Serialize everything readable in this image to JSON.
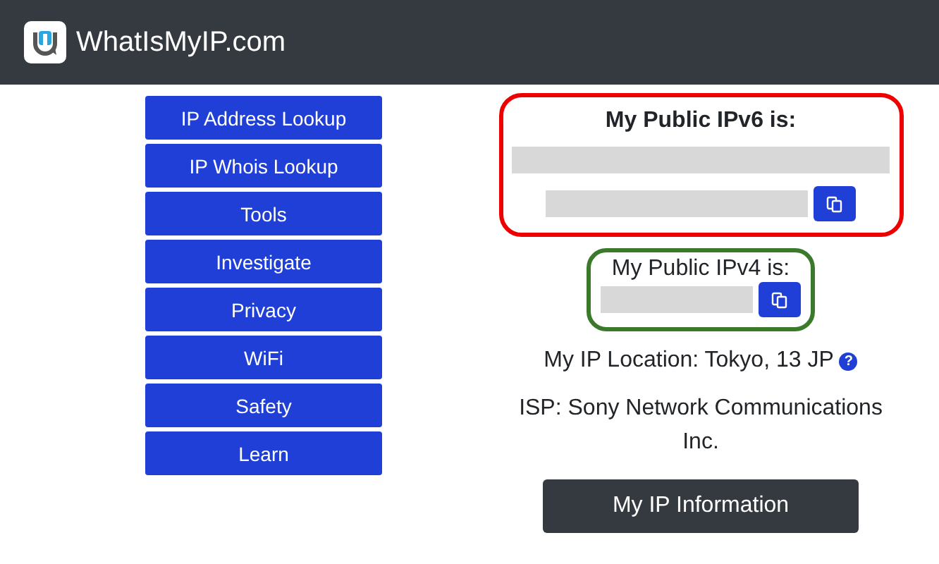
{
  "header": {
    "title": "WhatIsMyIP.com"
  },
  "nav": [
    {
      "label": "IP Address Lookup"
    },
    {
      "label": "IP Whois Lookup"
    },
    {
      "label": "Tools"
    },
    {
      "label": "Investigate"
    },
    {
      "label": "Privacy"
    },
    {
      "label": "WiFi"
    },
    {
      "label": "Safety"
    },
    {
      "label": "Learn"
    }
  ],
  "ipv6": {
    "heading": "My Public IPv6 is:",
    "color": "#ee0000"
  },
  "ipv4": {
    "heading": "My Public IPv4 is:",
    "color": "#3a7a2a"
  },
  "location": {
    "text": "My IP Location: Tokyo, 13 JP",
    "help_icon": "?"
  },
  "isp": "ISP: Sony Network Communications Inc.",
  "info_button": "My IP Information"
}
